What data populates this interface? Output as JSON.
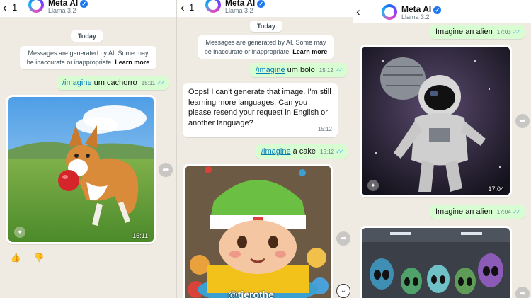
{
  "contact": {
    "name": "Meta AI",
    "subtitle": "Llama 3.2",
    "unread_count": "1"
  },
  "panel1": {
    "date": "Today",
    "notice": {
      "text": "Messages are generated by AI. Some may be inaccurate or inappropriate.",
      "link": "Learn more"
    },
    "message": {
      "command": "/imagine",
      "text": " um cachorro",
      "time": "15:11"
    },
    "image_time": "15:11"
  },
  "panel2": {
    "date": "Today",
    "notice": {
      "text": "Messages are generated by AI. Some may be inaccurate or inappropriate.",
      "link": "Learn more"
    },
    "message1": {
      "command": "/imagine",
      "text": " um bolo",
      "time": "15:12"
    },
    "reply": {
      "text": "Oops! I can't generate that image. I'm still learning more languages. Can you please resend your request in English or another language?",
      "time": "15:12"
    },
    "message2": {
      "command": "/imagine",
      "text": " a cake",
      "time": "15:12"
    },
    "image_caption": "@tierothe"
  },
  "panel3": {
    "message1": {
      "text": "Imagine an alien",
      "time": "17:03"
    },
    "image_time": "17:04",
    "message2": {
      "text": "Imagine an alien",
      "time": "17:04"
    }
  },
  "icons": {
    "back": "‹",
    "verified": "✓",
    "ticks": "✓✓",
    "forward": "➦",
    "thumbs_up": "👍",
    "thumbs_down": "👎",
    "chevron_down": "⌄",
    "sparkle": "✦"
  }
}
